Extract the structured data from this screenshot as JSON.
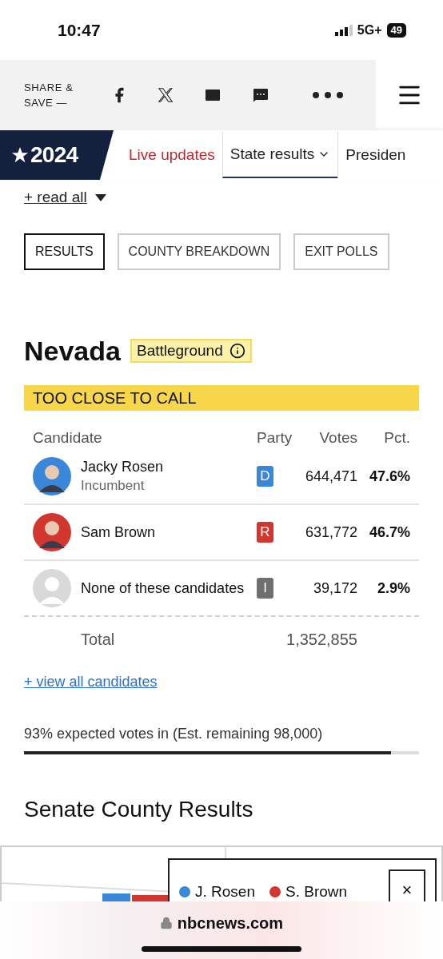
{
  "status_bar": {
    "time": "10:47",
    "network": "5G+",
    "battery": "49"
  },
  "share_bar": {
    "label_line1": "SHARE &",
    "label_line2": "SAVE —"
  },
  "nav": {
    "logo": "2024",
    "items": [
      {
        "label": "Live updates",
        "kind": "highlight",
        "selected": false
      },
      {
        "label": "State results",
        "kind": "dropdown",
        "selected": true
      },
      {
        "label": "Presiden",
        "kind": "plain",
        "selected": false
      }
    ]
  },
  "read_all": "+ read all",
  "tabs": [
    {
      "label": "RESULTS",
      "selected": true
    },
    {
      "label": "COUNTY BREAKDOWN",
      "selected": false
    },
    {
      "label": "EXIT POLLS",
      "selected": false
    }
  ],
  "race": {
    "state": "Nevada",
    "badge": "Battleground",
    "status": "TOO CLOSE TO CALL",
    "columns": [
      "Candidate",
      "Party",
      "Votes",
      "Pct."
    ],
    "rows": [
      {
        "name": "Jacky Rosen",
        "note": "Incumbent",
        "party": "D",
        "color": "#3a86d9",
        "votes": "644,471",
        "pct": "47.6%",
        "photo": true
      },
      {
        "name": "Sam Brown",
        "party": "R",
        "color": "#d2372f",
        "votes": "631,772",
        "pct": "46.7%",
        "photo": true
      },
      {
        "name": "None of these candidates",
        "party": "I",
        "color": "#6f6f6f",
        "votes": "39,172",
        "pct": "2.9%",
        "photo": false
      }
    ],
    "total_label": "Total",
    "total_votes": "1,352,855",
    "view_all": "+ view all candidates",
    "expected": "93% expected votes in (Est. remaining 98,000)",
    "level": 0.93
  },
  "county": {
    "title": "Senate County Results",
    "legend": [
      {
        "label": "J. Rosen",
        "color": "#3a86d9"
      },
      {
        "label": "S. Brown",
        "color": "#d2372f"
      }
    ],
    "close": "×"
  },
  "browser": {
    "url": "nbcnews.com"
  }
}
